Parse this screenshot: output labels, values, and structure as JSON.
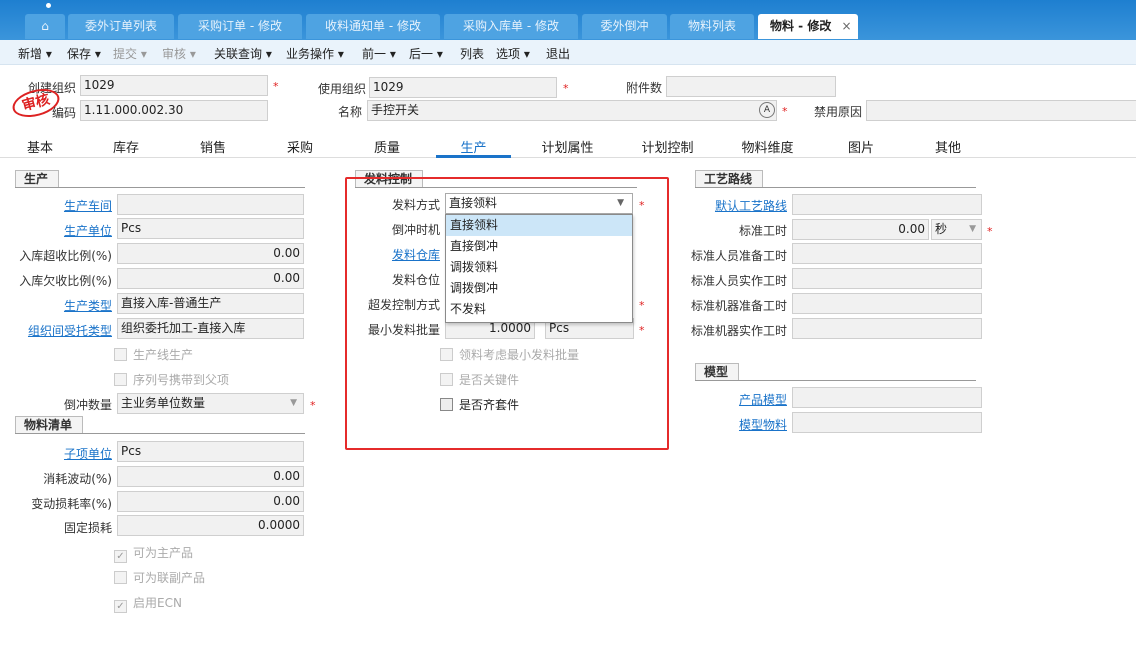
{
  "tabs": [
    {
      "label": ""
    },
    {
      "label": "委外订单列表"
    },
    {
      "label": "采购订单 - 修改"
    },
    {
      "label": "收料通知单 - 修改"
    },
    {
      "label": "采购入库单 - 修改"
    },
    {
      "label": "委外倒冲"
    },
    {
      "label": "物料列表"
    },
    {
      "label": "物料 - 修改"
    }
  ],
  "tab_close": "×",
  "toolbar": [
    "新增 ▾",
    "保存 ▾",
    "提交 ▾",
    "审核 ▾",
    "关联查询 ▾",
    "业务操作 ▾",
    "前一 ▾",
    "后一 ▾",
    "列表",
    "选项 ▾",
    "退出"
  ],
  "header": {
    "create_org_label": "创建组织",
    "create_org": "1029",
    "use_org_label": "使用组织",
    "use_org": "1029",
    "attach_label": "附件数",
    "attach": "",
    "code_label": "编码",
    "code": "1.11.000.002.30",
    "name_label": "名称",
    "name": "手控开关",
    "disable_label": "禁用原因",
    "disable": "",
    "stamp": "审核"
  },
  "page_tabs": [
    "基本",
    "库存",
    "销售",
    "采购",
    "质量",
    "生产",
    "计划属性",
    "计划控制",
    "物料维度",
    "图片",
    "其他"
  ],
  "production": {
    "title": "生产",
    "rows": [
      {
        "label": "生产车间",
        "value": ""
      },
      {
        "label": "生产单位",
        "value": "Pcs"
      },
      {
        "label": "入库超收比例(%)",
        "value": "0.00"
      },
      {
        "label": "入库欠收比例(%)",
        "value": "0.00"
      },
      {
        "label": "生产类型",
        "value": "直接入库-普通生产"
      },
      {
        "label": "组织间受托类型",
        "value": "组织委托加工-直接入库"
      }
    ],
    "cb1": "生产线生产",
    "cb2": "序列号携带到父项",
    "backflush_label": "倒冲数量",
    "backflush": "主业务单位数量"
  },
  "bom": {
    "title": "物料清单",
    "rows": [
      {
        "label": "子项单位",
        "value": "Pcs"
      },
      {
        "label": "消耗波动(%)",
        "value": "0.00"
      },
      {
        "label": "变动损耗率(%)",
        "value": "0.00"
      },
      {
        "label": "固定损耗",
        "value": "0.0000"
      }
    ],
    "cb": [
      "可为主产品",
      "可为联副产品",
      "启用ECN"
    ]
  },
  "issue": {
    "title": "发料控制",
    "method_label": "发料方式",
    "method": "直接领料",
    "timing_label": "倒冲时机",
    "wh_label": "发料仓库",
    "loc_label": "发料仓位",
    "over_label": "超发控制方式",
    "min_label": "最小发料批量",
    "min": "1.0000",
    "min_unit": "Pcs",
    "cb": [
      "领料考虑最小发料批量",
      "是否关键件",
      "是否齐套件"
    ],
    "options": [
      "直接领料",
      "直接倒冲",
      "调拨领料",
      "调拨倒冲",
      "不发料"
    ]
  },
  "routing": {
    "title": "工艺路线",
    "rows": [
      {
        "label": "默认工艺路线",
        "value": ""
      },
      {
        "label": "标准工时",
        "value": "0.00",
        "unit": "秒"
      },
      {
        "label": "标准人员准备工时",
        "value": ""
      },
      {
        "label": "标准人员实作工时",
        "value": ""
      },
      {
        "label": "标准机器准备工时",
        "value": ""
      },
      {
        "label": "标准机器实作工时",
        "value": ""
      }
    ]
  },
  "model": {
    "title": "模型",
    "rows": [
      {
        "label": "产品模型",
        "value": ""
      },
      {
        "label": "模型物料",
        "value": ""
      }
    ]
  },
  "required": "*"
}
